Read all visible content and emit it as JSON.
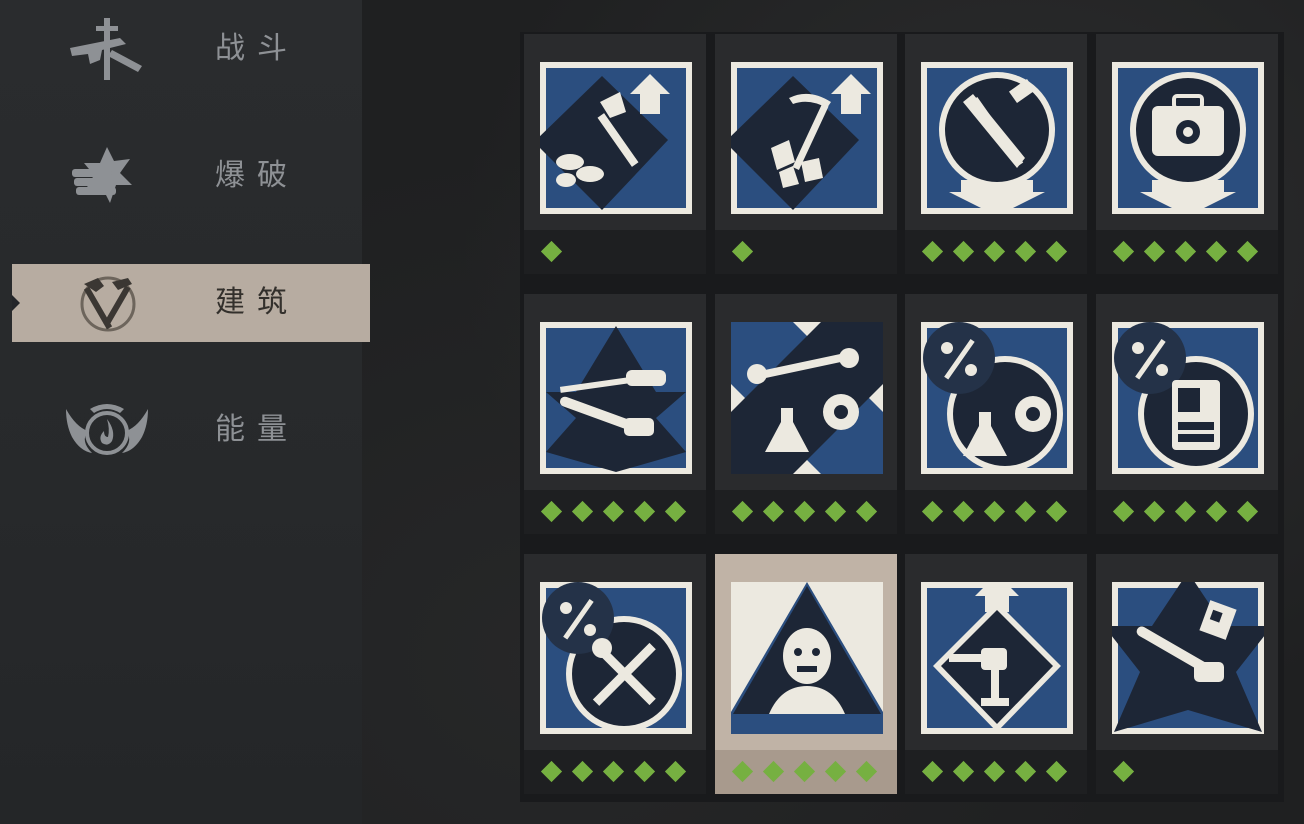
{
  "sidebar": {
    "categories": [
      {
        "label": "战斗",
        "icon": "combat-icon",
        "active": false
      },
      {
        "label": "爆破",
        "icon": "explosives-icon",
        "active": false
      },
      {
        "label": "建筑",
        "icon": "construction-icon",
        "active": true
      },
      {
        "label": "能量",
        "icon": "energy-icon",
        "active": false
      }
    ]
  },
  "perks": [
    {
      "icon": "woodcutting-upgrade-icon",
      "rating": 1,
      "selected": false
    },
    {
      "icon": "mining-upgrade-icon",
      "rating": 1,
      "selected": false
    },
    {
      "icon": "tools-cost-reduction-icon",
      "rating": 5,
      "selected": false
    },
    {
      "icon": "toolbox-cost-reduction-icon",
      "rating": 5,
      "selected": false
    },
    {
      "icon": "power-tools-icon",
      "rating": 5,
      "selected": false
    },
    {
      "icon": "workbench-research-icon",
      "rating": 5,
      "selected": false
    },
    {
      "icon": "research-discount-icon",
      "rating": 5,
      "selected": false
    },
    {
      "icon": "machine-discount-icon",
      "rating": 5,
      "selected": false
    },
    {
      "icon": "repair-discount-icon",
      "rating": 5,
      "selected": false
    },
    {
      "icon": "zombie-icon",
      "rating": 5,
      "selected": true
    },
    {
      "icon": "turret-upgrade-icon",
      "rating": 5,
      "selected": false
    },
    {
      "icon": "chainsaw-blueprint-icon",
      "rating": 1,
      "selected": false
    }
  ],
  "colors": {
    "rating": "#76b041",
    "tile_blue": "#2b4e7f",
    "tile_dark": "#1d2636",
    "paper": "#ece9e0",
    "selected_card": "#c0b3a6"
  }
}
